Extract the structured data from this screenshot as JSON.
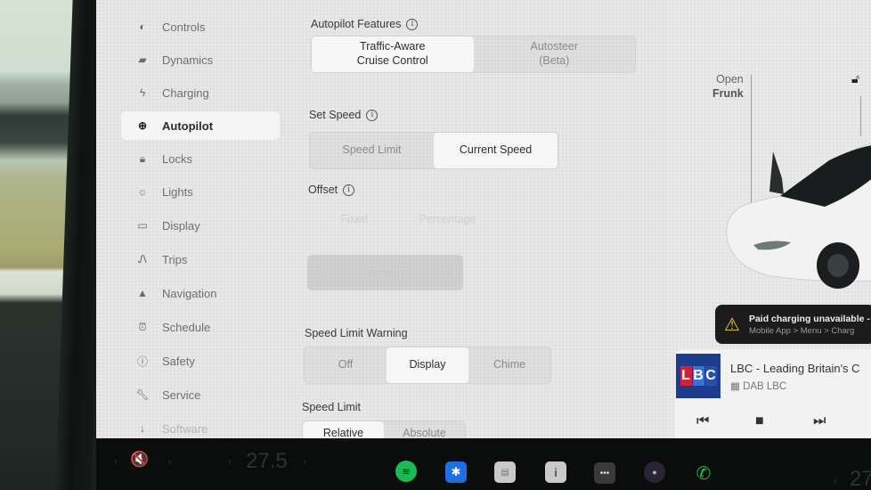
{
  "sidebar": {
    "items": [
      {
        "label": "Controls",
        "icon": "toggle-icon"
      },
      {
        "label": "Dynamics",
        "icon": "car-icon"
      },
      {
        "label": "Charging",
        "icon": "bolt-icon"
      },
      {
        "label": "Autopilot",
        "icon": "steering-wheel-icon",
        "active": true
      },
      {
        "label": "Locks",
        "icon": "lock-icon"
      },
      {
        "label": "Lights",
        "icon": "light-bulb-icon"
      },
      {
        "label": "Display",
        "icon": "display-icon"
      },
      {
        "label": "Trips",
        "icon": "trips-icon"
      },
      {
        "label": "Navigation",
        "icon": "navigation-arrow-icon"
      },
      {
        "label": "Schedule",
        "icon": "alarm-clock-icon"
      },
      {
        "label": "Safety",
        "icon": "safety-icon"
      },
      {
        "label": "Service",
        "icon": "wrench-icon"
      },
      {
        "label": "Software",
        "icon": "download-icon"
      }
    ]
  },
  "autopilot": {
    "features": {
      "title": "Autopilot Features",
      "options": [
        {
          "label": "Traffic-Aware\nCruise Control",
          "line1": "Traffic-Aware",
          "line2": "Cruise Control",
          "selected": true
        },
        {
          "label": "Autosteer (Beta)",
          "line1": "Autosteer",
          "line2": "(Beta)",
          "selected": false
        }
      ]
    },
    "set_speed": {
      "title": "Set Speed",
      "options": [
        {
          "label": "Speed Limit",
          "selected": false
        },
        {
          "label": "Current Speed",
          "selected": true
        }
      ]
    },
    "offset": {
      "title": "Offset",
      "options": [
        {
          "label": "Fixed",
          "disabled": true
        },
        {
          "label": "Percentage",
          "disabled": true
        }
      ],
      "stepper_value": "+0 mph",
      "minus": "−",
      "plus": "+"
    },
    "speed_limit_warning": {
      "title": "Speed Limit Warning",
      "options": [
        {
          "label": "Off",
          "selected": false
        },
        {
          "label": "Display",
          "selected": true
        },
        {
          "label": "Chime",
          "selected": false
        }
      ]
    },
    "speed_limit": {
      "title": "Speed Limit",
      "options": [
        {
          "label": "Relative",
          "selected": true
        },
        {
          "label": "Absolute",
          "selected": false
        }
      ]
    }
  },
  "car": {
    "frunk_line1": "Open",
    "frunk_line2": "Frunk",
    "lock_state": "unlocked"
  },
  "alert": {
    "title": "Paid charging unavailable -",
    "detail": "Mobile App > Menu > Charg"
  },
  "media": {
    "station_logo": [
      "L",
      "B",
      "C"
    ],
    "title": "LBC - Leading Britain's C",
    "source": "DAB LBC",
    "controls": {
      "prev": "⏮",
      "stop": "■",
      "next": "⏭"
    }
  },
  "taskbar": {
    "volume_icon": "🔇",
    "driver_temp": "27.5",
    "passenger_temp": "27.",
    "apps": [
      "spotify",
      "bluetooth",
      "calendar",
      "notes",
      "more",
      "camera",
      "phone"
    ]
  },
  "colors": {
    "spotify": "#1db954",
    "bluetooth": "#1f6fe0",
    "phone": "#22c23a",
    "alert_icon": "#e8c24a"
  }
}
